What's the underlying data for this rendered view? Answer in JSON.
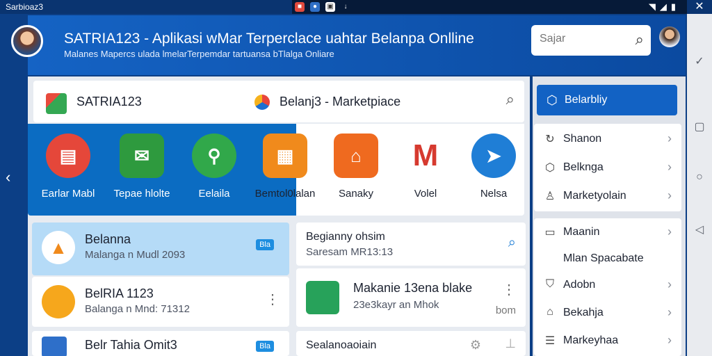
{
  "status_bar": {
    "left_text": "Sarbioaz3",
    "notif_icons": [
      "app-icon-red",
      "app-icon-blue",
      "app-icon-image",
      "download-icon"
    ],
    "right_icons": [
      "wifi-icon",
      "signal-icon",
      "battery-icon"
    ]
  },
  "header": {
    "title": "SATRIA123 - Aplikasi wMar Terperclace uahtar Belanpa Onlline",
    "subtitle": "Malanes Mapercs ulada lmelarTerpemdar tartuansa bTlalga Onliare",
    "search_placeholder": "Sajar"
  },
  "topbar": {
    "store_name": "SATRIA123",
    "marketplace_label": "Belanj3 - Marketpiace"
  },
  "apps": [
    {
      "label": "Earlar Mabl",
      "icon": "store-icon",
      "color": "#e5473a"
    },
    {
      "label": "Tepae hlolte",
      "icon": "envelope-icon",
      "color": "#2e9a3e"
    },
    {
      "label": "Eelaila",
      "icon": "location-pin-icon",
      "color": "#31a84a"
    },
    {
      "label": "Bemtol0lalan",
      "icon": "shopping-bag-icon",
      "color": "#f08a1c"
    },
    {
      "label": "Sanaky",
      "icon": "shop-icon",
      "color": "#ef6a1f"
    },
    {
      "label": "Volel",
      "icon": "mail-icon",
      "color": "#d63a2f"
    },
    {
      "label": "Nelsa",
      "icon": "send-icon",
      "color": "#1f7ed6"
    }
  ],
  "cards": [
    {
      "title": "Belanna",
      "subtitle": "Malanga n Mudl 2093",
      "badge": "Bla"
    },
    {
      "title": "Begianny ohsim",
      "subtitle": "Saresam MR13:13"
    },
    {
      "title": "BelRIA 1123",
      "subtitle": "Balanga n Mnd: 71312"
    },
    {
      "title": "Makanie 13ena blake",
      "subtitle": "23e3kayr an Mhok",
      "extra": "bom"
    },
    {
      "title": "Belr Tahia Omit3",
      "badge": "Bla"
    },
    {
      "title": "Sealanoaoiain"
    }
  ],
  "right_panel": {
    "primary_button": "Belarbliy",
    "group1": [
      {
        "label": "Shanon",
        "icon": "refresh-icon"
      },
      {
        "label": "Belknga",
        "icon": "box-icon"
      },
      {
        "label": "Marketyolain",
        "icon": "user-icon"
      }
    ],
    "group2": [
      {
        "label": "Maanin",
        "icon": "folder-icon"
      },
      {
        "label": "Mlan Spacabate",
        "icon": ""
      },
      {
        "label": "Adobn",
        "icon": "shield-icon"
      },
      {
        "label": "Bekahja",
        "icon": "store-icon"
      },
      {
        "label": "Markeyhaa",
        "icon": "list-icon"
      }
    ]
  }
}
